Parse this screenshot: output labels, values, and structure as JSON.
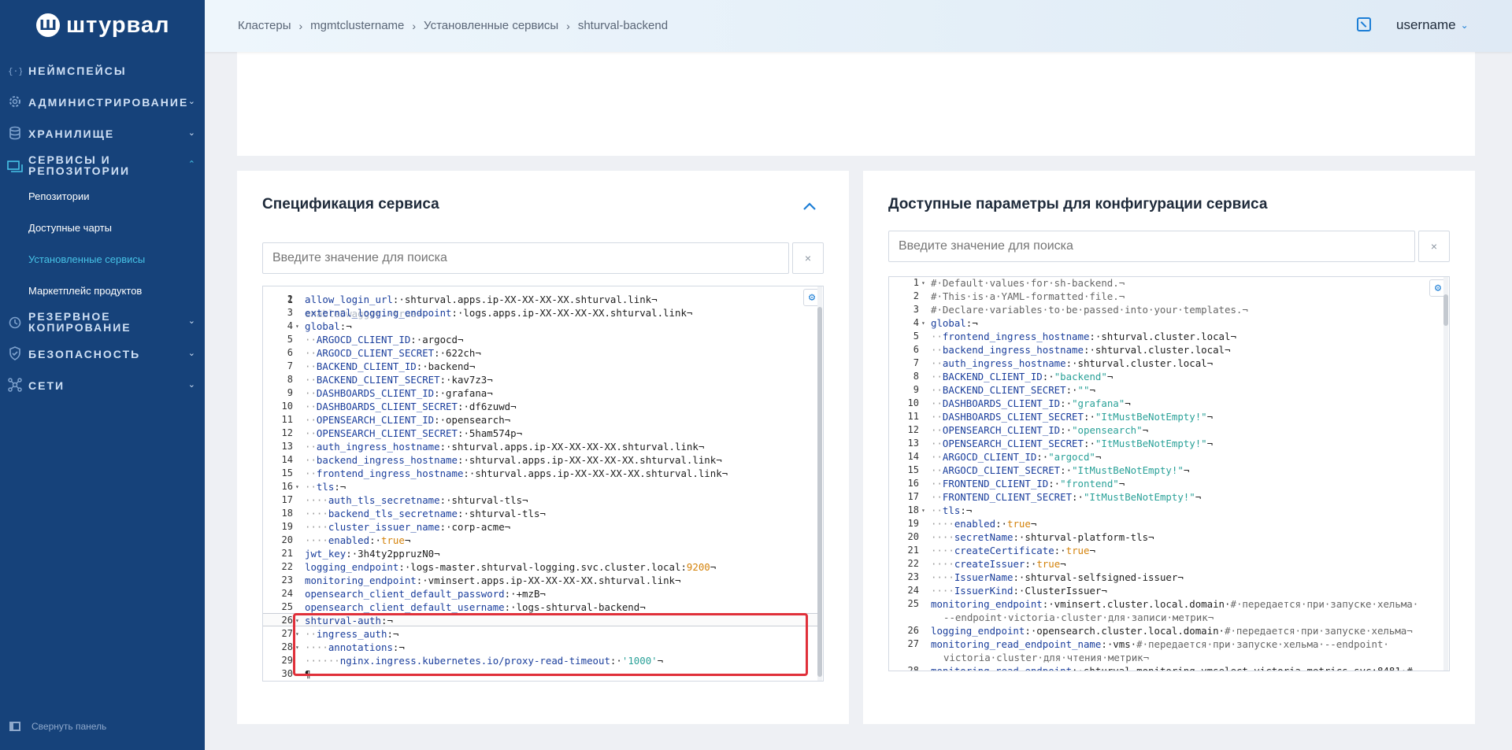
{
  "logo": {
    "mark": "Ш",
    "text": "штурвал"
  },
  "sidebar": {
    "items": [
      {
        "label": "НЕЙМСПЕЙСЫ",
        "icon": "namespace-icon",
        "expandable": false
      },
      {
        "label": "АДМИНИСТРИРОВАНИЕ",
        "icon": "gear-icon",
        "expandable": true
      },
      {
        "label": "ХРАНИЛИЩЕ",
        "icon": "database-icon",
        "expandable": true
      },
      {
        "label": "СЕРВИСЫ И РЕПОЗИТОРИИ",
        "icon": "services-icon",
        "expandable": true,
        "expanded": true
      },
      {
        "label": "РЕЗЕРВНОЕ КОПИРОВАНИЕ",
        "icon": "backup-icon",
        "expandable": true
      },
      {
        "label": "БЕЗОПАСНОСТЬ",
        "icon": "shield-icon",
        "expandable": true
      },
      {
        "label": "СЕТИ",
        "icon": "network-icon",
        "expandable": true
      }
    ],
    "subitems": [
      {
        "label": "Репозитории",
        "active": false
      },
      {
        "label": "Доступные чарты",
        "active": false
      },
      {
        "label": "Установленные сервисы",
        "active": true
      },
      {
        "label": "Маркетплейс продуктов",
        "active": false
      }
    ],
    "collapse_label": "Свернуть панель"
  },
  "header": {
    "breadcrumb": [
      "Кластеры",
      "mgmtclustername",
      "Установленные сервисы",
      "shturval-backend"
    ],
    "username": "username"
  },
  "left_panel": {
    "title": "Спецификация сервиса",
    "search_placeholder": "Введите значение для поиска",
    "clear": "×",
    "partial_top": "enableSwagger:·true¬",
    "lines": [
      {
        "n": "2",
        "k": "allow_login_url",
        "v": "·shturval.apps.ip-XX-XX-XX-XX.shturval.link¬"
      },
      {
        "n": "3",
        "k": "external_logging_endpoint",
        "v": "·logs.apps.ip-XX-XX-XX-XX.shturval.link¬"
      },
      {
        "n": "4",
        "k": "global",
        "v": "¬",
        "fold": true
      },
      {
        "n": "5",
        "i": "··",
        "k": "ARGOCD_CLIENT_ID",
        "v": "·argocd¬"
      },
      {
        "n": "6",
        "i": "··",
        "k": "ARGOCD_CLIENT_SECRET",
        "v": "·622ch¬"
      },
      {
        "n": "7",
        "i": "··",
        "k": "BACKEND_CLIENT_ID",
        "v": "·backend¬"
      },
      {
        "n": "8",
        "i": "··",
        "k": "BACKEND_CLIENT_SECRET",
        "v": "·kav7z3¬"
      },
      {
        "n": "9",
        "i": "··",
        "k": "DASHBOARDS_CLIENT_ID",
        "v": "·grafana¬"
      },
      {
        "n": "10",
        "i": "··",
        "k": "DASHBOARDS_CLIENT_SECRET",
        "v": "·df6zuwd¬"
      },
      {
        "n": "11",
        "i": "··",
        "k": "OPENSEARCH_CLIENT_ID",
        "v": "·opensearch¬"
      },
      {
        "n": "12",
        "i": "··",
        "k": "OPENSEARCH_CLIENT_SECRET",
        "v": "·5ham574p¬"
      },
      {
        "n": "13",
        "i": "··",
        "k": "auth_ingress_hostname",
        "v": "·shturval.apps.ip-XX-XX-XX-XX.shturval.link¬"
      },
      {
        "n": "14",
        "i": "··",
        "k": "backend_ingress_hostname",
        "v": "·shturval.apps.ip-XX-XX-XX-XX.shturval.link¬"
      },
      {
        "n": "15",
        "i": "··",
        "k": "frontend_ingress_hostname",
        "v": "·shturval.apps.ip-XX-XX-XX-XX.shturval.link¬"
      },
      {
        "n": "16",
        "i": "··",
        "k": "tls",
        "v": "¬",
        "fold": true
      },
      {
        "n": "17",
        "i": "····",
        "k": "auth_tls_secretname",
        "v": "·shturval-tls¬"
      },
      {
        "n": "18",
        "i": "····",
        "k": "backend_tls_secretname",
        "v": "·shturval-tls¬"
      },
      {
        "n": "19",
        "i": "····",
        "k": "cluster_issuer_name",
        "v": "·corp-acme¬"
      },
      {
        "n": "20",
        "i": "····",
        "k": "enabled",
        "bv": "true",
        "v": "¬"
      },
      {
        "n": "21",
        "k": "jwt_key",
        "v": "·3h4ty2ppruzN0¬"
      },
      {
        "n": "22",
        "k": "logging_endpoint",
        "v": "·logs-master.shturval-logging.svc.cluster.local:",
        "bv": "9200",
        "v2": "¬"
      },
      {
        "n": "23",
        "k": "monitoring_endpoint",
        "v": "·vminsert.apps.ip-XX-XX-XX-XX.shturval.link¬"
      },
      {
        "n": "24",
        "k": "opensearch_client_default_password",
        "v": "·+mzB¬"
      },
      {
        "n": "25",
        "k": "opensearch_client_default_username",
        "v": "·logs-shturval-backend¬"
      },
      {
        "n": "26",
        "k": "shturval-auth",
        "v": "¬",
        "fold": true
      },
      {
        "n": "27",
        "i": "··",
        "k": "ingress_auth",
        "v": "¬",
        "fold": true
      },
      {
        "n": "28",
        "i": "····",
        "k": "annotations",
        "v": "¬",
        "fold": true
      },
      {
        "n": "29",
        "i": "······",
        "k": "nginx.ingress.kubernetes.io/proxy-read-timeout",
        "v": "·",
        "sv": "'1000'",
        "v2": "¬"
      },
      {
        "n": "30",
        "k": "",
        "v": "¶"
      }
    ]
  },
  "right_panel": {
    "title": "Доступные параметры для конфигурации сервиса",
    "search_placeholder": "Введите значение для поиска",
    "clear": "×",
    "lines": [
      {
        "n": "1",
        "c": "#·Default·values·for·sh-backend.¬",
        "fold": true
      },
      {
        "n": "2",
        "c": "#·This·is·a·YAML-formatted·file.¬"
      },
      {
        "n": "3",
        "c": "#·Declare·variables·to·be·passed·into·your·templates.¬"
      },
      {
        "n": "4",
        "k": "global",
        "v": "¬",
        "fold": true
      },
      {
        "n": "5",
        "i": "··",
        "k": "frontend_ingress_hostname",
        "v": "·shturval.cluster.local¬"
      },
      {
        "n": "6",
        "i": "··",
        "k": "backend_ingress_hostname",
        "v": "·shturval.cluster.local¬"
      },
      {
        "n": "7",
        "i": "··",
        "k": "auth_ingress_hostname",
        "v": "·shturval.cluster.local¬"
      },
      {
        "n": "8",
        "i": "··",
        "k": "BACKEND_CLIENT_ID",
        "v": "·",
        "sv": "\"backend\"",
        "v2": "¬"
      },
      {
        "n": "9",
        "i": "··",
        "k": "BACKEND_CLIENT_SECRET",
        "v": "·",
        "sv": "\"\"",
        "v2": "¬"
      },
      {
        "n": "10",
        "i": "··",
        "k": "DASHBOARDS_CLIENT_ID",
        "v": "·",
        "sv": "\"grafana\"",
        "v2": "¬"
      },
      {
        "n": "11",
        "i": "··",
        "k": "DASHBOARDS_CLIENT_SECRET",
        "v": "·",
        "sv": "\"ItMustBeNotEmpty!\"",
        "v2": "¬"
      },
      {
        "n": "12",
        "i": "··",
        "k": "OPENSEARCH_CLIENT_ID",
        "v": "·",
        "sv": "\"opensearch\"",
        "v2": "¬"
      },
      {
        "n": "13",
        "i": "··",
        "k": "OPENSEARCH_CLIENT_SECRET",
        "v": "·",
        "sv": "\"ItMustBeNotEmpty!\"",
        "v2": "¬"
      },
      {
        "n": "14",
        "i": "··",
        "k": "ARGOCD_CLIENT_ID",
        "v": "·",
        "sv": "\"argocd\"",
        "v2": "¬"
      },
      {
        "n": "15",
        "i": "··",
        "k": "ARGOCD_CLIENT_SECRET",
        "v": "·",
        "sv": "\"ItMustBeNotEmpty!\"",
        "v2": "¬"
      },
      {
        "n": "16",
        "i": "··",
        "k": "FRONTEND_CLIENT_ID",
        "v": "·",
        "sv": "\"frontend\"",
        "v2": "¬"
      },
      {
        "n": "17",
        "i": "··",
        "k": "FRONTEND_CLIENT_SECRET",
        "v": "·",
        "sv": "\"ItMustBeNotEmpty!\"",
        "v2": "¬"
      },
      {
        "n": "18",
        "i": "··",
        "k": "tls",
        "v": "¬",
        "fold": true
      },
      {
        "n": "19",
        "i": "····",
        "k": "enabled",
        "bv": "true",
        "v": "¬"
      },
      {
        "n": "20",
        "i": "····",
        "k": "secretName",
        "v": "·shturval-platform-tls¬"
      },
      {
        "n": "21",
        "i": "····",
        "k": "createCertificate",
        "bv": "true",
        "v": "¬"
      },
      {
        "n": "22",
        "i": "····",
        "k": "createIssuer",
        "bv": "true",
        "v": "¬"
      },
      {
        "n": "23",
        "i": "····",
        "k": "IssuerName",
        "v": "·shturval-selfsigned-issuer¬"
      },
      {
        "n": "24",
        "i": "····",
        "k": "IssuerKind",
        "v": "·ClusterIssuer¬"
      },
      {
        "n": "25",
        "k": "monitoring_endpoint",
        "v": "·vminsert.cluster.local.domain·",
        "cm": "#·передается·при·запуске·хельма·",
        "wrap": "--endpoint·victoria·cluster·для·записи·метрик¬"
      },
      {
        "n": "26",
        "k": "logging_endpoint",
        "v": "·opensearch.cluster.local.domain·",
        "cm": "#·передается·при·запуске·хельма¬"
      },
      {
        "n": "27",
        "k": "monitoring_read_endpoint_name",
        "v": "·vms·",
        "cm": "#·передается·при·запуске·хельма·--endpoint·",
        "wrap": "victoria·cluster·для·чтения·метрик¬"
      },
      {
        "n": "28",
        "k": "monitoring_read_endpoint",
        "v": "·shturval-monitoring-vmselect-victoria-metrics-svc:8481·#"
      }
    ]
  },
  "colors": {
    "sidebar_bg": "#16427a",
    "accent": "#1c7ed6",
    "active_sub": "#46c2e6",
    "highlight": "#e0303a"
  }
}
